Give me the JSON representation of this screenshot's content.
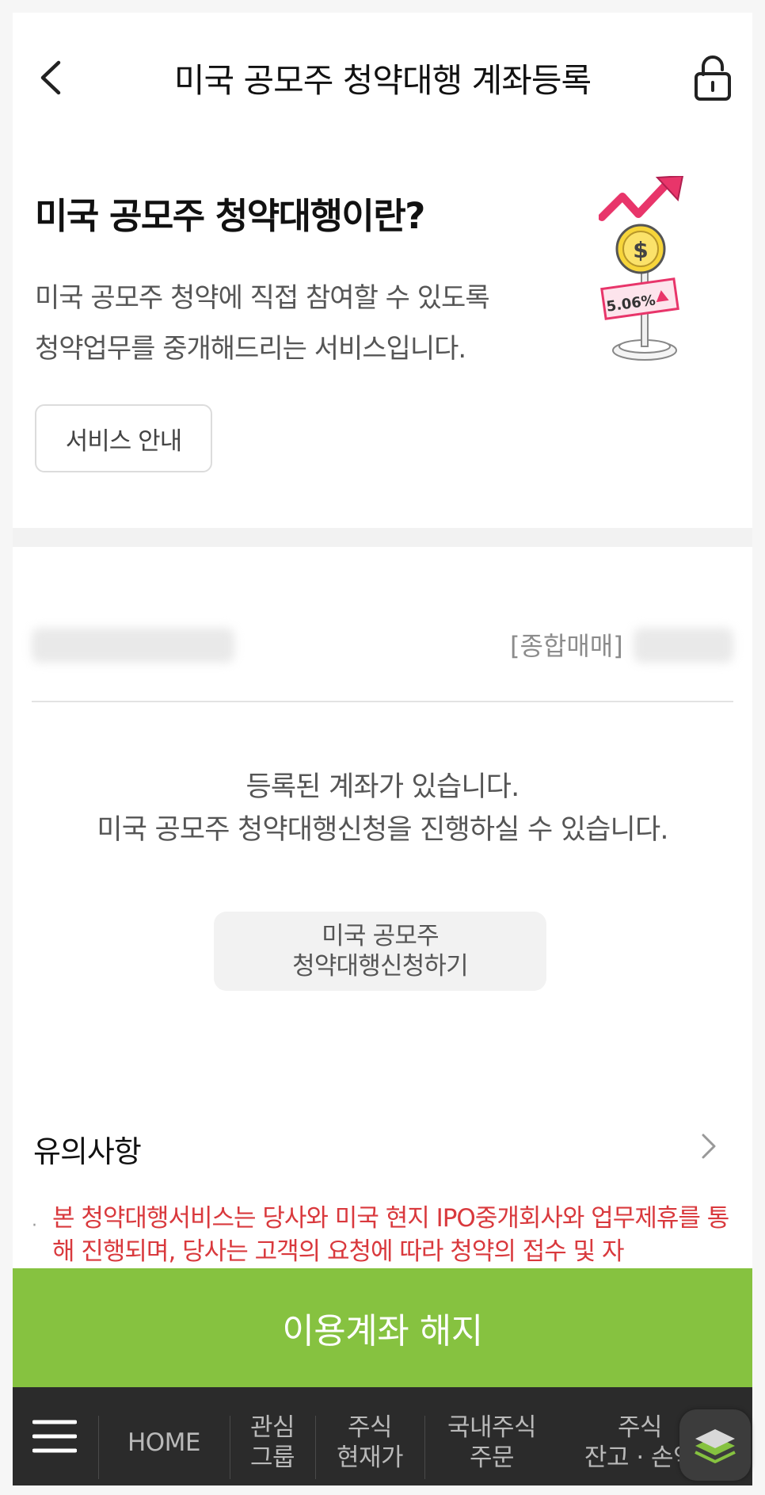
{
  "header": {
    "title": "미국 공모주 청약대행 계좌등록"
  },
  "intro": {
    "title": "미국 공모주 청약대행이란?",
    "description_line1": "미국 공모주 청약에 직접 참여할 수 있도록",
    "description_line2": "청약업무를 중개해드리는 서비스입니다.",
    "service_button": "서비스 안내",
    "illustration_rate": "5.06%"
  },
  "account": {
    "type_label": "[종합매매]"
  },
  "status": {
    "line1": "등록된 계좌가 있습니다.",
    "line2": "미국 공모주 청약대행신청을 진행하실 수 있습니다."
  },
  "apply_button": {
    "line1": "미국 공모주",
    "line2": "청약대행신청하기"
  },
  "notice": {
    "title": "유의사항",
    "bullet": "·",
    "text": "본 청약대행서비스는 당사와 미국 현지 IPO중개회사와 업무제휴를 통해 진행되며, 당사는 고객의 요청에 따라 청약의 접수 및 자"
  },
  "terminate_button": "이용계좌 해지",
  "bottom_nav": {
    "items": [
      {
        "line1": "HOME",
        "line2": ""
      },
      {
        "line1": "관심",
        "line2": "그룹"
      },
      {
        "line1": "주식",
        "line2": "현재가"
      },
      {
        "line1": "국내주식",
        "line2": "주문"
      },
      {
        "line1": "주식",
        "line2": "잔고 · 손익"
      }
    ]
  },
  "colors": {
    "accent_green": "#86c240",
    "notice_red": "#d9393d",
    "nav_bg": "#2b2b2b"
  }
}
